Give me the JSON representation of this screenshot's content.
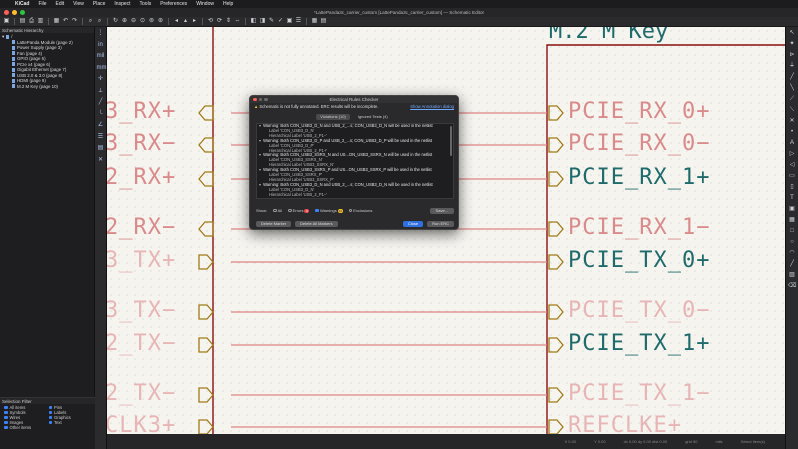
{
  "menubar": {
    "app": "KiCad",
    "items": [
      "File",
      "Edit",
      "View",
      "Place",
      "Inspect",
      "Tools",
      "Preferences",
      "Window",
      "Help"
    ]
  },
  "window": {
    "title": "*LattePanda3c_carrier_custom [LattePanda3c_carrier_custom] — Schematic Editor"
  },
  "hierarchy": {
    "title": "Schematic Hierarchy",
    "root": "/",
    "items": [
      "LattePanda Module (page 2)",
      "Power Supply (page 3)",
      "Fan (page 4)",
      "GPIO (page 5)",
      "PCIe x4 (page 6)",
      "Gigabit Ethernet (page 7)",
      "USB 2.0 & 3.0 (page 8)",
      "HDMI (page 9)",
      "M.2 M Key (page 10)"
    ]
  },
  "selection_filter": {
    "title": "Selection Filter",
    "items": [
      "All items",
      "Pins",
      "Symbols",
      "Labels",
      "Wires",
      "Graphics",
      "Images",
      "Text",
      "Other items"
    ]
  },
  "canvas": {
    "sheet_title": "M.2  M  Key",
    "left_labels": [
      "3_RX+",
      "3_RX−",
      "2_RX+",
      "2_RX−",
      "3_TX+",
      "3_TX−",
      "2_TX−",
      "2_TX−",
      "CLK3+"
    ],
    "right_labels": [
      "PCIE_RX_0+",
      "PCIE_RX_0−",
      "PCIE_RX_1+",
      "PCIE_RX_1−",
      "PCIE_TX_0+",
      "PCIE_TX_0−",
      "PCIE_TX_1+",
      "PCIE_TX_1−",
      "REFCLKE+"
    ]
  },
  "dialog": {
    "title": "Electrical Rules Checker",
    "warning": "Schematic is not fully annotated. ERC results will be incomplete.",
    "show_annotation_link": "Show Annotation dialog",
    "tabs": [
      "Violations (10)",
      "Ignored Tests (4)"
    ],
    "violations": [
      {
        "text": "Warning: Both CON_USB3_D_N and USB_2_...s; CON_USB3_D_N will be used in the netlist",
        "label": "Label 'CON_USB3_D_N'",
        "hlabel": "Hierarchical Label 'USB_2_P1−'"
      },
      {
        "text": "Warning: Both CON_USB3_D_P and USB_2_...s; CON_USB3_D_P will be used in the netlist",
        "label": "Label 'CON_USB3_D_P'",
        "hlabel": "Hierarchical Label 'USB_2_P1+'"
      },
      {
        "text": "Warning: Both CON_USB3_SSRX_N and US...ON_USB3_SSRX_N will be used in the netlist",
        "label": "Label 'CON_USB3_SSRX_N'",
        "hlabel": "Hierarchical Label 'USB3_SSRX_N'"
      },
      {
        "text": "Warning: Both CON_USB3_SSRX_P and US...ON_USB3_SSRX_P will be used in the netlist",
        "label": "Label 'CON_USB3_SSRX_P'",
        "hlabel": "Hierarchical Label 'USB3_SSRX_P'"
      },
      {
        "text": "Warning: Both CON_USB3_D_N and USB_2_...s; CON_USB3_D_N will be used in the netlist",
        "label": "Label 'CON_USB3_D_N'",
        "hlabel": "Hierarchical Label 'USB_2_P1−'"
      }
    ],
    "show_label": "Show:",
    "filters": {
      "all": "All",
      "errors": "Errors",
      "errors_count": "0",
      "warnings": "Warnings",
      "warnings_count": "10",
      "exclusions": "Exclusions"
    },
    "save_button": "Save...",
    "buttons": {
      "delete_marker": "Delete Marker",
      "delete_all": "Delete All Markers",
      "close": "Close",
      "run": "Run ERC"
    }
  },
  "status": {
    "items": [
      "X 0.00",
      "Y 0.00",
      "dx 0.00  dy 0.00  dist 0.00",
      "grid 50",
      "mils",
      "Select item(s)"
    ]
  },
  "colors": {
    "wire": "#e08585",
    "sheet": "#8a0f0f",
    "label_dark": "#1f6b6b",
    "accent": "#2f6fe0"
  }
}
